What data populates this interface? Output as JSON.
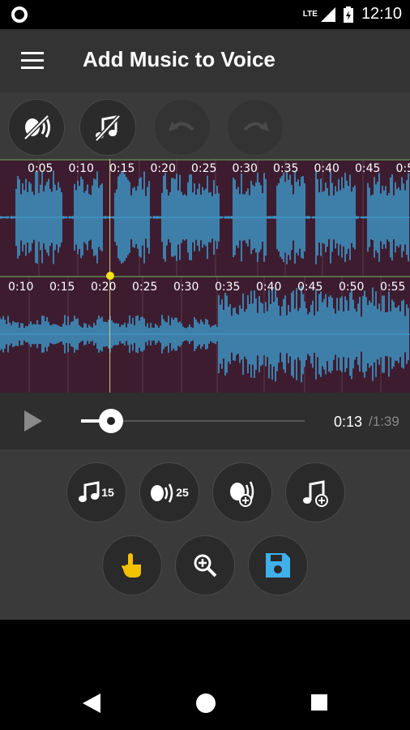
{
  "status": {
    "network": "LTE",
    "clock": "12:10"
  },
  "app": {
    "title": "Add Music to Voice"
  },
  "toolbar": {
    "voice_effect_icon": "voice-effect-icon",
    "music_effect_icon": "music-effect-icon",
    "undo_icon": "undo-icon",
    "redo_icon": "redo-icon"
  },
  "voice_track": {
    "ticks": [
      "0:05",
      "0:10",
      "0:15",
      "0:20",
      "0:25",
      "0:30",
      "0:35",
      "0:40",
      "0:45",
      "0:5"
    ]
  },
  "music_track": {
    "ticks": [
      "0:10",
      "0:15",
      "0:20",
      "0:25",
      "0:30",
      "0:35",
      "0:40",
      "0:45",
      "0:50",
      "0:55"
    ]
  },
  "player": {
    "current": "0:13",
    "total": "/1:39",
    "progress": 0.13
  },
  "actions": {
    "music_volume": "15",
    "voice_volume": "25"
  },
  "colors": {
    "wave": "#3ea0d2",
    "wave_bg": "#3d1c30",
    "grid": "#6fbf5a",
    "marker": "#f5e100",
    "save_icon": "#3fb0ea",
    "touch_icon": "#f2c200"
  }
}
